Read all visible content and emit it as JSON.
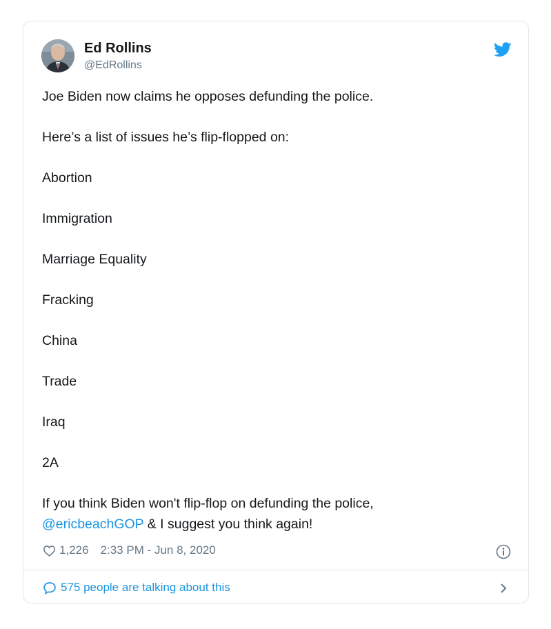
{
  "author": {
    "name": "Ed Rollins",
    "handle": "@EdRollins"
  },
  "tweet": {
    "paragraphs": [
      "Joe Biden now claims he opposes defunding the police.",
      "Here’s a list of issues he’s flip-flopped on:",
      "Abortion",
      "Immigration",
      "Marriage Equality",
      "Fracking",
      "China",
      "Trade",
      "Iraq",
      "2A",
      "If you think Biden won't flip-flop on defunding the police,"
    ],
    "mention": "@ericbeachGOP",
    "closing": " & I suggest you think again!"
  },
  "meta": {
    "likes": "1,226",
    "timestamp": "2:33 PM - Jun 8, 2020"
  },
  "footer": {
    "talking": "575 people are talking about this"
  },
  "icons": {
    "brand": "twitter-bird-icon",
    "like": "heart-outline-icon",
    "info": "info-circle-icon",
    "comment": "speech-bubble-icon",
    "navigate": "chevron-right-icon"
  },
  "colors": {
    "accent": "#1da1f2",
    "link": "#1b95e0",
    "muted": "#657786",
    "border": "#e1e8ed"
  }
}
